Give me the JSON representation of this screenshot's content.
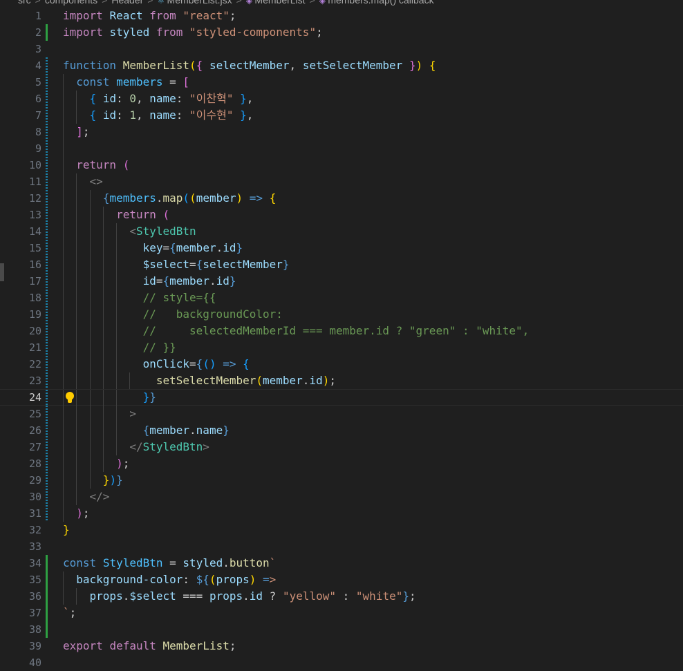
{
  "breadcrumb": {
    "items": [
      "src",
      "components",
      "Header",
      "MemberList.jsx",
      "MemberList",
      "members.map() callback"
    ],
    "separator": ">"
  },
  "editor": {
    "current_line": 24,
    "lines": [
      {
        "n": "1",
        "guides": [],
        "gutter": "",
        "tokens": [
          [
            "kw",
            "import"
          ],
          [
            "tx",
            " "
          ],
          [
            "vr",
            "React"
          ],
          [
            "tx",
            " "
          ],
          [
            "kw",
            "from"
          ],
          [
            "tx",
            " "
          ],
          [
            "st",
            "\"react\""
          ],
          [
            "tx",
            ";"
          ]
        ]
      },
      {
        "n": "2",
        "guides": [],
        "gutter": "add",
        "tokens": [
          [
            "kw",
            "import"
          ],
          [
            "tx",
            " "
          ],
          [
            "vr",
            "styled"
          ],
          [
            "tx",
            " "
          ],
          [
            "kw",
            "from"
          ],
          [
            "tx",
            " "
          ],
          [
            "st",
            "\"styled-components\""
          ],
          [
            "tx",
            ";"
          ]
        ]
      },
      {
        "n": "3",
        "guides": [],
        "gutter": "",
        "tokens": []
      },
      {
        "n": "4",
        "guides": [],
        "gutter": "mod",
        "tokens": [
          [
            "sk",
            "function"
          ],
          [
            "tx",
            " "
          ],
          [
            "fn",
            "MemberList"
          ],
          [
            "br1",
            "("
          ],
          [
            "br2",
            "{"
          ],
          [
            "tx",
            " "
          ],
          [
            "vr",
            "selectMember"
          ],
          [
            "tx",
            ", "
          ],
          [
            "vr",
            "setSelectMember"
          ],
          [
            "tx",
            " "
          ],
          [
            "br2",
            "}"
          ],
          [
            "br1",
            ")"
          ],
          [
            "tx",
            " "
          ],
          [
            "br1",
            "{"
          ]
        ]
      },
      {
        "n": "5",
        "guides": [
          1
        ],
        "gutter": "mod",
        "tokens": [
          [
            "tx",
            "  "
          ],
          [
            "sk",
            "const"
          ],
          [
            "tx",
            " "
          ],
          [
            "cn",
            "members"
          ],
          [
            "tx",
            " = "
          ],
          [
            "br2",
            "["
          ]
        ]
      },
      {
        "n": "6",
        "guides": [
          1,
          2
        ],
        "gutter": "mod",
        "tokens": [
          [
            "tx",
            "    "
          ],
          [
            "br3",
            "{"
          ],
          [
            "tx",
            " "
          ],
          [
            "vr",
            "id"
          ],
          [
            "tx",
            ": "
          ],
          [
            "nm",
            "0"
          ],
          [
            "tx",
            ", "
          ],
          [
            "vr",
            "name"
          ],
          [
            "tx",
            ": "
          ],
          [
            "st",
            "\"이찬혁\""
          ],
          [
            "tx",
            " "
          ],
          [
            "br3",
            "}"
          ],
          [
            "tx",
            ","
          ]
        ]
      },
      {
        "n": "7",
        "guides": [
          1,
          2
        ],
        "gutter": "mod",
        "tokens": [
          [
            "tx",
            "    "
          ],
          [
            "br3",
            "{"
          ],
          [
            "tx",
            " "
          ],
          [
            "vr",
            "id"
          ],
          [
            "tx",
            ": "
          ],
          [
            "nm",
            "1"
          ],
          [
            "tx",
            ", "
          ],
          [
            "vr",
            "name"
          ],
          [
            "tx",
            ": "
          ],
          [
            "st",
            "\"이수현\""
          ],
          [
            "tx",
            " "
          ],
          [
            "br3",
            "}"
          ],
          [
            "tx",
            ","
          ]
        ]
      },
      {
        "n": "8",
        "guides": [
          1
        ],
        "gutter": "mod",
        "tokens": [
          [
            "tx",
            "  "
          ],
          [
            "br2",
            "]"
          ],
          [
            "tx",
            ";"
          ]
        ]
      },
      {
        "n": "9",
        "guides": [
          1
        ],
        "gutter": "mod",
        "tokens": []
      },
      {
        "n": "10",
        "guides": [
          1
        ],
        "gutter": "mod",
        "tokens": [
          [
            "tx",
            "  "
          ],
          [
            "kw",
            "return"
          ],
          [
            "tx",
            " "
          ],
          [
            "br2",
            "("
          ]
        ]
      },
      {
        "n": "11",
        "guides": [
          1,
          2
        ],
        "gutter": "mod",
        "tokens": [
          [
            "tx",
            "    "
          ],
          [
            "pt",
            "<>"
          ]
        ]
      },
      {
        "n": "12",
        "guides": [
          1,
          2,
          3
        ],
        "gutter": "mod",
        "tokens": [
          [
            "tx",
            "      "
          ],
          [
            "sk",
            "{"
          ],
          [
            "cn",
            "members"
          ],
          [
            "tx",
            "."
          ],
          [
            "fn",
            "map"
          ],
          [
            "br3",
            "("
          ],
          [
            "br1",
            "("
          ],
          [
            "vr",
            "member"
          ],
          [
            "br1",
            ")"
          ],
          [
            "tx",
            " "
          ],
          [
            "sk",
            "=>"
          ],
          [
            "tx",
            " "
          ],
          [
            "br1",
            "{"
          ]
        ]
      },
      {
        "n": "13",
        "guides": [
          1,
          2,
          3,
          4
        ],
        "gutter": "mod",
        "tokens": [
          [
            "tx",
            "        "
          ],
          [
            "kw",
            "return"
          ],
          [
            "tx",
            " "
          ],
          [
            "br2",
            "("
          ]
        ]
      },
      {
        "n": "14",
        "guides": [
          1,
          2,
          3,
          4,
          5
        ],
        "gutter": "mod",
        "tokens": [
          [
            "tx",
            "          "
          ],
          [
            "pt",
            "<"
          ],
          [
            "tg",
            "StyledBtn"
          ]
        ]
      },
      {
        "n": "15",
        "guides": [
          1,
          2,
          3,
          4,
          5
        ],
        "gutter": "mod",
        "tokens": [
          [
            "tx",
            "            "
          ],
          [
            "vr",
            "key"
          ],
          [
            "tx",
            "="
          ],
          [
            "sk",
            "{"
          ],
          [
            "vr",
            "member"
          ],
          [
            "tx",
            "."
          ],
          [
            "vr",
            "id"
          ],
          [
            "sk",
            "}"
          ]
        ]
      },
      {
        "n": "16",
        "guides": [
          1,
          2,
          3,
          4,
          5
        ],
        "gutter": "mod",
        "tokens": [
          [
            "tx",
            "            "
          ],
          [
            "vr",
            "$select"
          ],
          [
            "tx",
            "="
          ],
          [
            "sk",
            "{"
          ],
          [
            "vr",
            "selectMember"
          ],
          [
            "sk",
            "}"
          ]
        ]
      },
      {
        "n": "17",
        "guides": [
          1,
          2,
          3,
          4,
          5
        ],
        "gutter": "mod",
        "tokens": [
          [
            "tx",
            "            "
          ],
          [
            "vr",
            "id"
          ],
          [
            "tx",
            "="
          ],
          [
            "sk",
            "{"
          ],
          [
            "vr",
            "member"
          ],
          [
            "tx",
            "."
          ],
          [
            "vr",
            "id"
          ],
          [
            "sk",
            "}"
          ]
        ]
      },
      {
        "n": "18",
        "guides": [
          1,
          2,
          3,
          4,
          5
        ],
        "gutter": "mod",
        "tokens": [
          [
            "tx",
            "            "
          ],
          [
            "cm",
            "// style={{"
          ]
        ]
      },
      {
        "n": "19",
        "guides": [
          1,
          2,
          3,
          4,
          5
        ],
        "gutter": "mod",
        "tokens": [
          [
            "tx",
            "            "
          ],
          [
            "cm",
            "//   backgroundColor:"
          ]
        ]
      },
      {
        "n": "20",
        "guides": [
          1,
          2,
          3,
          4,
          5
        ],
        "gutter": "mod",
        "tokens": [
          [
            "tx",
            "            "
          ],
          [
            "cm",
            "//     selectedMemberId === member.id ? \"green\" : \"white\","
          ]
        ]
      },
      {
        "n": "21",
        "guides": [
          1,
          2,
          3,
          4,
          5
        ],
        "gutter": "mod",
        "tokens": [
          [
            "tx",
            "            "
          ],
          [
            "cm",
            "// }}"
          ]
        ]
      },
      {
        "n": "22",
        "guides": [
          1,
          2,
          3,
          4,
          5
        ],
        "gutter": "mod",
        "tokens": [
          [
            "tx",
            "            "
          ],
          [
            "vr",
            "onClick"
          ],
          [
            "tx",
            "="
          ],
          [
            "sk",
            "{"
          ],
          [
            "br3",
            "("
          ],
          [
            "br3",
            ")"
          ],
          [
            "tx",
            " "
          ],
          [
            "sk",
            "=>"
          ],
          [
            "tx",
            " "
          ],
          [
            "br3",
            "{"
          ]
        ]
      },
      {
        "n": "23",
        "guides": [
          1,
          2,
          3,
          4,
          5,
          6
        ],
        "gutter": "mod",
        "tokens": [
          [
            "tx",
            "              "
          ],
          [
            "fn",
            "setSelectMember"
          ],
          [
            "br1",
            "("
          ],
          [
            "vr",
            "member"
          ],
          [
            "tx",
            "."
          ],
          [
            "vr",
            "id"
          ],
          [
            "br1",
            ")"
          ],
          [
            "tx",
            ";"
          ]
        ]
      },
      {
        "n": "24",
        "guides": [
          1,
          2,
          3,
          4,
          5
        ],
        "gutter": "mod",
        "bulb": true,
        "tokens": [
          [
            "tx",
            "            "
          ],
          [
            "br3",
            "}"
          ],
          [
            "sk",
            "}"
          ]
        ]
      },
      {
        "n": "25",
        "guides": [
          1,
          2,
          3,
          4,
          5
        ],
        "gutter": "mod",
        "tokens": [
          [
            "tx",
            "          "
          ],
          [
            "pt",
            ">"
          ]
        ]
      },
      {
        "n": "26",
        "guides": [
          1,
          2,
          3,
          4,
          5
        ],
        "gutter": "mod",
        "tokens": [
          [
            "tx",
            "            "
          ],
          [
            "sk",
            "{"
          ],
          [
            "vr",
            "member"
          ],
          [
            "tx",
            "."
          ],
          [
            "vr",
            "name"
          ],
          [
            "sk",
            "}"
          ]
        ]
      },
      {
        "n": "27",
        "guides": [
          1,
          2,
          3,
          4,
          5
        ],
        "gutter": "mod",
        "tokens": [
          [
            "tx",
            "          "
          ],
          [
            "pt",
            "</"
          ],
          [
            "tg",
            "StyledBtn"
          ],
          [
            "pt",
            ">"
          ]
        ]
      },
      {
        "n": "28",
        "guides": [
          1,
          2,
          3,
          4
        ],
        "gutter": "mod",
        "tokens": [
          [
            "tx",
            "        "
          ],
          [
            "br2",
            ")"
          ],
          [
            "tx",
            ";"
          ]
        ]
      },
      {
        "n": "29",
        "guides": [
          1,
          2,
          3
        ],
        "gutter": "mod",
        "tokens": [
          [
            "tx",
            "      "
          ],
          [
            "br1",
            "}"
          ],
          [
            "br3",
            ")"
          ],
          [
            "sk",
            "}"
          ]
        ]
      },
      {
        "n": "30",
        "guides": [
          1,
          2
        ],
        "gutter": "mod",
        "tokens": [
          [
            "tx",
            "    "
          ],
          [
            "pt",
            "</>"
          ]
        ]
      },
      {
        "n": "31",
        "guides": [
          1
        ],
        "gutter": "mod",
        "tokens": [
          [
            "tx",
            "  "
          ],
          [
            "br2",
            ")"
          ],
          [
            "tx",
            ";"
          ]
        ]
      },
      {
        "n": "32",
        "guides": [],
        "gutter": "",
        "tokens": [
          [
            "br1",
            "}"
          ]
        ]
      },
      {
        "n": "33",
        "guides": [],
        "gutter": "",
        "tokens": []
      },
      {
        "n": "34",
        "guides": [],
        "gutter": "add",
        "tokens": [
          [
            "sk",
            "const"
          ],
          [
            "tx",
            " "
          ],
          [
            "cn",
            "StyledBtn"
          ],
          [
            "tx",
            " = "
          ],
          [
            "vr",
            "styled"
          ],
          [
            "tx",
            "."
          ],
          [
            "fn",
            "button"
          ],
          [
            "st",
            "`"
          ]
        ]
      },
      {
        "n": "35",
        "guides": [
          1
        ],
        "gutter": "add",
        "tokens": [
          [
            "tx",
            "  "
          ],
          [
            "vr",
            "background-color"
          ],
          [
            "tx",
            ": "
          ],
          [
            "sk",
            "${"
          ],
          [
            "br1",
            "("
          ],
          [
            "vr",
            "props"
          ],
          [
            "br1",
            ")"
          ],
          [
            "tx",
            " "
          ],
          [
            "sk",
            "="
          ],
          [
            "st",
            ">"
          ]
        ]
      },
      {
        "n": "36",
        "guides": [
          1,
          2
        ],
        "gutter": "add",
        "tokens": [
          [
            "tx",
            "    "
          ],
          [
            "vr",
            "props"
          ],
          [
            "tx",
            "."
          ],
          [
            "vr",
            "$select"
          ],
          [
            "tx",
            " === "
          ],
          [
            "vr",
            "props"
          ],
          [
            "tx",
            "."
          ],
          [
            "vr",
            "id"
          ],
          [
            "tx",
            " ? "
          ],
          [
            "st",
            "\"yellow\""
          ],
          [
            "tx",
            " : "
          ],
          [
            "st",
            "\"white\""
          ],
          [
            "sk",
            "}"
          ],
          [
            "tx",
            ";"
          ]
        ]
      },
      {
        "n": "37",
        "guides": [],
        "gutter": "add",
        "tokens": [
          [
            "st",
            "`"
          ],
          [
            "tx",
            ";"
          ]
        ]
      },
      {
        "n": "38",
        "guides": [],
        "gutter": "add",
        "tokens": []
      },
      {
        "n": "39",
        "guides": [],
        "gutter": "",
        "tokens": [
          [
            "kw",
            "export"
          ],
          [
            "tx",
            " "
          ],
          [
            "kw",
            "default"
          ],
          [
            "tx",
            " "
          ],
          [
            "fn",
            "MemberList"
          ],
          [
            "tx",
            ";"
          ]
        ]
      },
      {
        "n": "40",
        "guides": [],
        "gutter": "",
        "tokens": []
      }
    ]
  }
}
